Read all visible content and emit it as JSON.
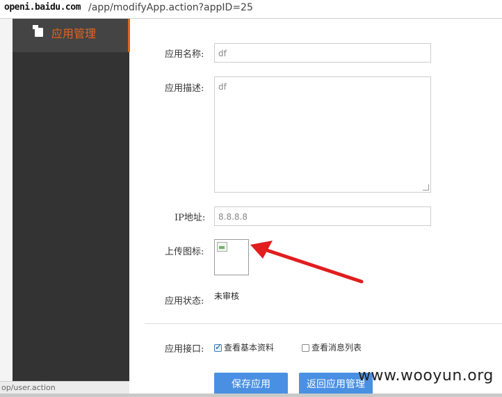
{
  "browser": {
    "url_host": "openi.baidu.com",
    "url_path": "/app/modifyApp.action?appID=25",
    "status_url": "op/user.action"
  },
  "sidebar": {
    "items": [
      {
        "label": "应用管理",
        "icon": "document-icon",
        "active": true
      }
    ]
  },
  "form": {
    "app_name": {
      "label": "应用名称:",
      "value": "df"
    },
    "app_desc": {
      "label": "应用描述:",
      "value": "df"
    },
    "ip": {
      "label": "IP地址:",
      "value": "8.8.8.8"
    },
    "icon_upload": {
      "label": "上传图标:"
    },
    "status": {
      "label": "应用状态:",
      "value": "未审核"
    },
    "api": {
      "label": "应用接口:",
      "options": [
        {
          "label": "查看基本资料",
          "checked": true
        },
        {
          "label": "查看消息列表",
          "checked": false
        }
      ]
    },
    "save_label": "保存应用",
    "back_label": "返回应用管理"
  },
  "watermark": "www.wooyun.org",
  "colors": {
    "accent": "#e8641e",
    "sidebar_bg": "#333333",
    "button_bg": "#4a90e2",
    "annotation_arrow": "#e11d1d"
  }
}
